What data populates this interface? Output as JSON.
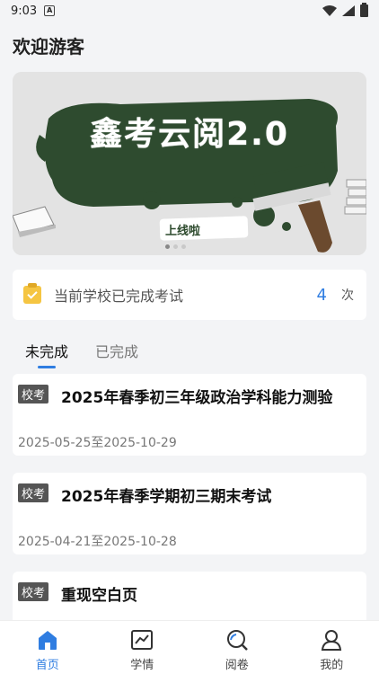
{
  "status_bar": {
    "time": "9:03",
    "notification_icon": "A"
  },
  "header": {
    "welcome": "欢迎游客"
  },
  "banner": {
    "title": "鑫考云阅2.0",
    "subtitle": "上线啦",
    "dots": 3,
    "active_dot": 0
  },
  "exam_summary": {
    "label": "当前学校已完成考试",
    "count": "4",
    "unit": "次"
  },
  "tabs": [
    {
      "label": "未完成",
      "active": true
    },
    {
      "label": "已完成",
      "active": false
    }
  ],
  "exams": [
    {
      "tag": "校考",
      "title": "2025年春季初三年级政治学科能力测验",
      "dates": "2025-05-25至2025-10-29"
    },
    {
      "tag": "校考",
      "title": "2025年春季学期初三期末考试",
      "dates": "2025-04-21至2025-10-28"
    },
    {
      "tag": "校考",
      "title": "重现空白页",
      "dates": ""
    }
  ],
  "bottom_nav": [
    {
      "label": "首页",
      "icon": "home-icon",
      "active": true
    },
    {
      "label": "学情",
      "icon": "chart-icon",
      "active": false
    },
    {
      "label": "阅卷",
      "icon": "search-icon",
      "active": false
    },
    {
      "label": "我的",
      "icon": "user-icon",
      "active": false
    }
  ],
  "colors": {
    "accent": "#2f7de1",
    "banner_green": "#2d4a2d",
    "tag_bg": "#555555",
    "clip_yellow": "#f5c542"
  }
}
